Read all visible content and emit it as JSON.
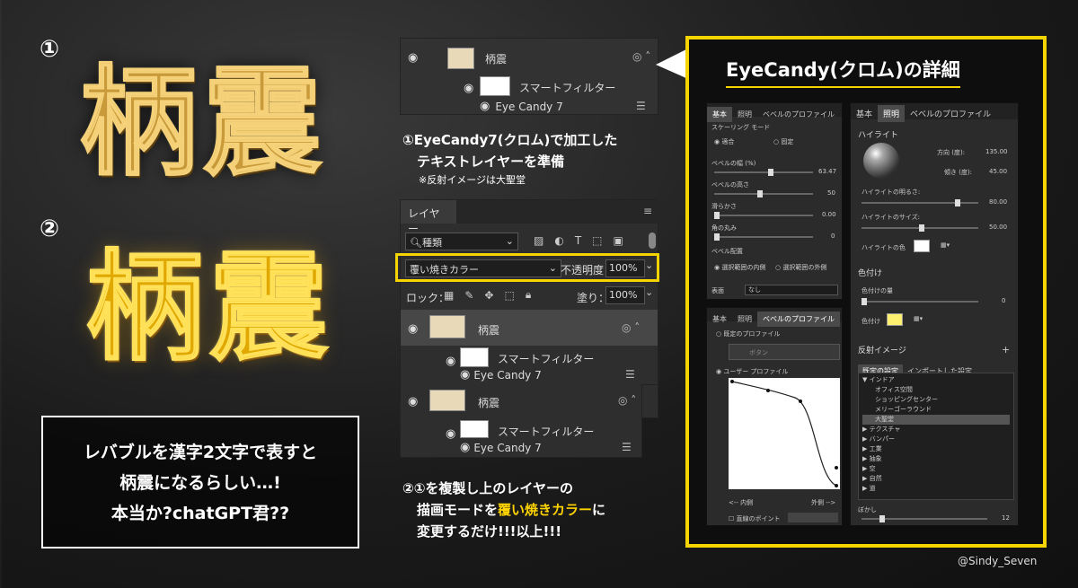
{
  "left": {
    "num1": "①",
    "num2": "②",
    "kanji1": "柄震",
    "kanji2": "柄震",
    "note_lines": [
      "レバブルを漢字2文字で表すと",
      "柄震になるらしい…!",
      "本当か?chatGPT君??"
    ]
  },
  "layer_top": {
    "name": "柄震",
    "smart_filter": "スマートフィルター",
    "filter": "Eye Candy 7"
  },
  "caption1": {
    "line1": "①EyeCandy7(クロム)で加工した",
    "line2": "テキストレイヤーを準備",
    "note": "※反射イメージは大聖堂"
  },
  "layers_panel": {
    "tab": "レイヤー",
    "search": "種類",
    "blend_mode": "覆い焼きカラー",
    "opacity_label": "不透明度：",
    "opacity": "100%",
    "lock_label": "ロック：",
    "fill_label": "塗り：",
    "fill": "100%",
    "layers": [
      {
        "name": "柄震",
        "smart_filter": "スマートフィルター",
        "filter": "Eye Candy 7"
      },
      {
        "name": "柄震",
        "smart_filter": "スマートフィルター",
        "filter": "Eye Candy 7"
      }
    ]
  },
  "caption2": {
    "line1": "②①を複製し上のレイヤーの",
    "line2a": "描画モードを",
    "line2b": "覆い焼きカラー",
    "line2c": "に",
    "line3": "変更するだけ!!!以上!!!"
  },
  "detail": {
    "title": "EyeCandy(クロム)の詳細",
    "p1": {
      "tabs": [
        "基本",
        "照明",
        "ベベルのプロファイル"
      ],
      "scale_label": "スケーリング モード",
      "opt1": "適合",
      "opt2": "固定",
      "sliders": [
        {
          "label": "ベベルの幅 (%)",
          "value": "63.47"
        },
        {
          "label": "ベベルの高さ",
          "value": "50"
        },
        {
          "label": "滑らかさ",
          "value": "0.00"
        },
        {
          "label": "角の丸み",
          "value": "0"
        }
      ],
      "placement_label": "ベベル配置",
      "inside": "選択範囲の内側",
      "outside": "選択範囲の外側",
      "surface_label": "表面",
      "surface": "なし"
    },
    "p2": {
      "tabs": [
        "基本",
        "照明",
        "ベベルのプロファイル"
      ],
      "preset_label": "既定のプロファイル",
      "preset": "ボタン",
      "user_label": "ユーザー プロファイル",
      "in": "<-- 内側",
      "out": "外側 -->",
      "straight": "直線のポイント"
    },
    "p3": {
      "tabs": [
        "基本",
        "照明",
        "ベベルのプロファイル"
      ],
      "highlight": "ハイライト",
      "dir_label": "方向 (度):",
      "dir": "135.00",
      "tilt_label": "傾き (度):",
      "tilt": "45.00",
      "bright_label": "ハイライトの明るさ:",
      "bright": "80.00",
      "size_label": "ハイライトのサイズ:",
      "size": "50.00",
      "color_label": "ハイライトの色",
      "tint": "色付け",
      "tint_amt_label": "色付けの量",
      "tint_amt": "0",
      "tint_color_label": "色付け",
      "reflect": "反射イメージ",
      "rtabs": [
        "既定の設定",
        "インポートした設定"
      ],
      "tree": [
        "▼ インドア",
        "オフィス空間",
        "ショッピングセンター",
        "メリーゴーラウンド",
        "大聖堂",
        "▶ テクスチャ",
        "▶ バンパー",
        "▶ 工業",
        "▶ 抽象",
        "▶ 空",
        "▶ 自然",
        "▶ 道"
      ],
      "blur_label": "ぼかし",
      "blur": "12"
    }
  },
  "credit": "@Sindy_Seven",
  "colors": {
    "accent": "#f5d400"
  }
}
